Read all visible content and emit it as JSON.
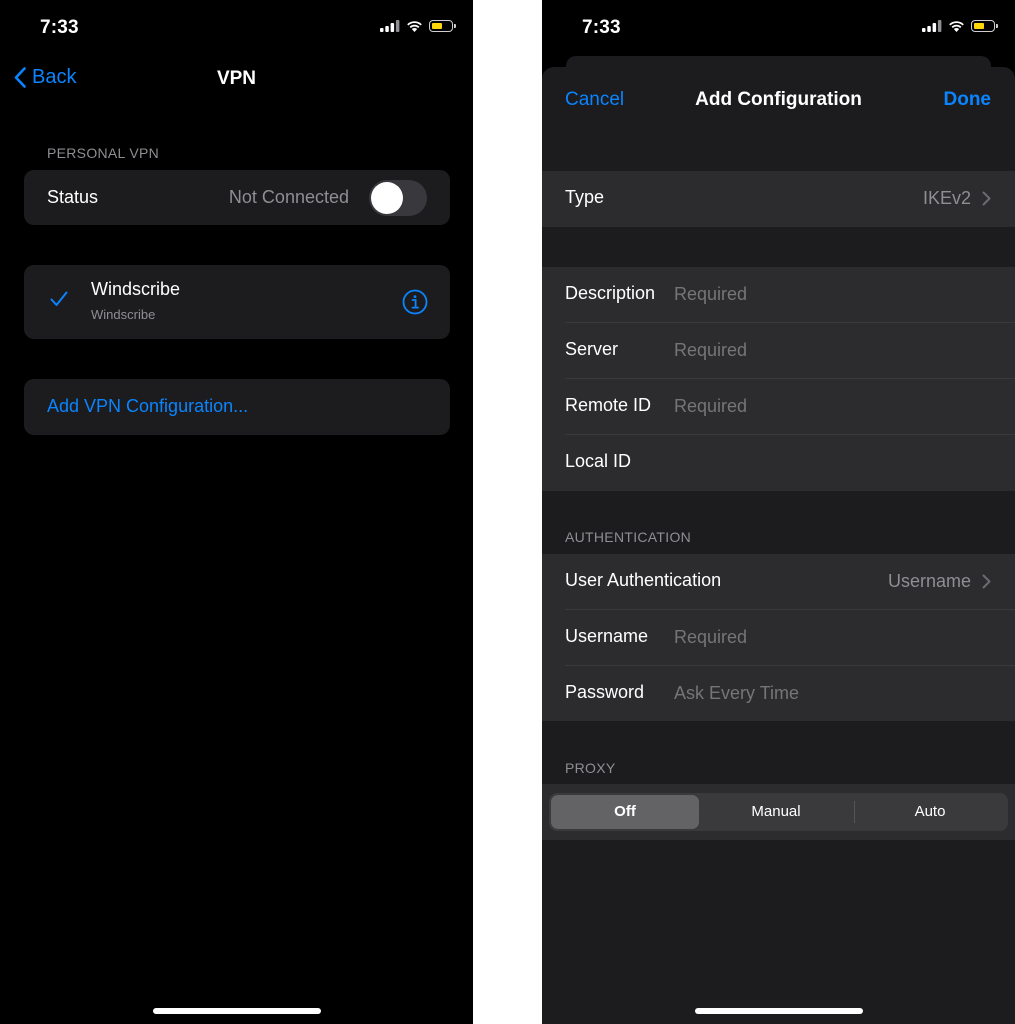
{
  "left_screen": {
    "status_bar": {
      "time": "7:33"
    },
    "nav": {
      "back_label": "Back",
      "title": "VPN"
    },
    "personal_vpn": {
      "header": "PERSONAL VPN",
      "status_label": "Status",
      "status_value": "Not Connected",
      "toggle_on": false
    },
    "vpn_entry": {
      "name": "Windscribe",
      "subtitle": "Windscribe",
      "selected": true
    },
    "add_config_label": "Add VPN Configuration..."
  },
  "right_screen": {
    "status_bar": {
      "time": "7:33"
    },
    "sheet": {
      "cancel_label": "Cancel",
      "title": "Add Configuration",
      "done_label": "Done"
    },
    "type_row": {
      "label": "Type",
      "value": "IKEv2"
    },
    "fields": [
      {
        "label": "Description",
        "placeholder": "Required"
      },
      {
        "label": "Server",
        "placeholder": "Required"
      },
      {
        "label": "Remote ID",
        "placeholder": "Required"
      },
      {
        "label": "Local ID",
        "placeholder": ""
      }
    ],
    "authentication": {
      "header": "AUTHENTICATION",
      "user_auth_label": "User Authentication",
      "user_auth_value": "Username",
      "username_label": "Username",
      "username_placeholder": "Required",
      "password_label": "Password",
      "password_placeholder": "Ask Every Time"
    },
    "proxy": {
      "header": "PROXY",
      "options": [
        "Off",
        "Manual",
        "Auto"
      ],
      "selected": "Off"
    }
  },
  "colors": {
    "accent": "#0a84ff",
    "background": "#000000",
    "grouped_cell": "#1c1c1e",
    "secondary_text": "#8e8e93",
    "battery": "#ffd60a"
  }
}
